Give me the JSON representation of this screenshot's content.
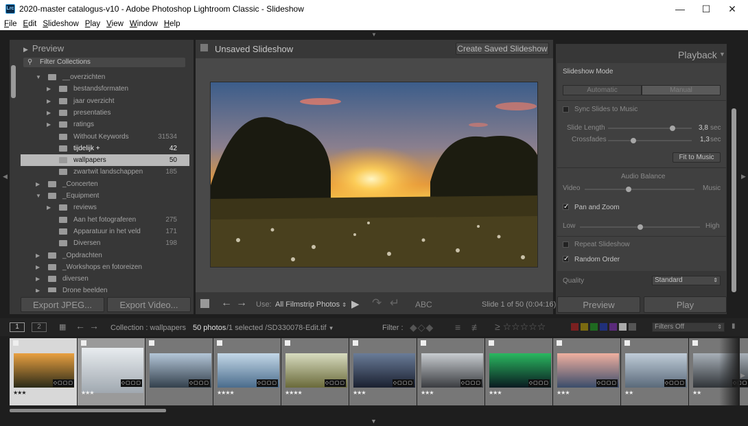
{
  "window": {
    "title": "2020-master catalogus-v10 - Adobe Photoshop Lightroom Classic - Slideshow",
    "logo": "Lrc"
  },
  "menu": [
    "File",
    "Edit",
    "Slideshow",
    "Play",
    "View",
    "Window",
    "Help"
  ],
  "left": {
    "preview_label": "Preview",
    "filter_label": "Filter Collections",
    "tree": [
      {
        "label": "__overzichten",
        "count": "",
        "indent": 0,
        "open": true
      },
      {
        "label": "bestandsformaten",
        "count": "",
        "indent": 1
      },
      {
        "label": "jaar overzicht",
        "count": "",
        "indent": 1
      },
      {
        "label": "presentaties",
        "count": "",
        "indent": 1
      },
      {
        "label": "ratings",
        "count": "",
        "indent": 1
      },
      {
        "label": "Without Keywords",
        "count": "31534",
        "indent": 1,
        "leaf": true
      },
      {
        "label": "tijdelijk  +",
        "count": "42",
        "indent": 1,
        "leaf": true,
        "bold": true
      },
      {
        "label": "wallpapers",
        "count": "50",
        "indent": 1,
        "leaf": true,
        "sel": true
      },
      {
        "label": "zwartwit landschappen",
        "count": "185",
        "indent": 1,
        "leaf": true
      },
      {
        "label": "_Concerten",
        "count": "",
        "indent": 0
      },
      {
        "label": "_Equipment",
        "count": "",
        "indent": 0,
        "open": true
      },
      {
        "label": "reviews",
        "count": "",
        "indent": 1
      },
      {
        "label": "Aan het fotograferen",
        "count": "275",
        "indent": 1,
        "leaf": true
      },
      {
        "label": "Apparatuur in het veld",
        "count": "171",
        "indent": 1,
        "leaf": true
      },
      {
        "label": "Diversen",
        "count": "198",
        "indent": 1,
        "leaf": true
      },
      {
        "label": "_Opdrachten",
        "count": "",
        "indent": 0
      },
      {
        "label": "_Workshops en fotoreizen",
        "count": "",
        "indent": 0
      },
      {
        "label": "diversen",
        "count": "",
        "indent": 0
      },
      {
        "label": "Drone beelden",
        "count": "",
        "indent": 0
      }
    ],
    "export_jpeg": "Export JPEG...",
    "export_video": "Export Video..."
  },
  "center": {
    "title": "Unsaved Slideshow",
    "create_btn": "Create Saved Slideshow",
    "use_label": "Use:",
    "use_value": "All Filmstrip Photos",
    "abc": "ABC",
    "slide_info": "Slide 1 of 50 (0:04:16)"
  },
  "right": {
    "playback": "Playback",
    "mode_label": "Slideshow Mode",
    "automatic": "Automatic",
    "manual": "Manual",
    "sync": "Sync Slides to Music",
    "slide_length": "Slide Length",
    "slide_length_val": "3,8",
    "crossfades": "Crossfades",
    "crossfades_val": "1,3",
    "sec": "sec",
    "fit_music": "Fit to Music",
    "audio_balance": "Audio Balance",
    "video": "Video",
    "music": "Music",
    "pan_zoom": "Pan and Zoom",
    "low": "Low",
    "high": "High",
    "repeat": "Repeat Slideshow",
    "random": "Random Order",
    "quality": "Quality",
    "quality_val": "Standard",
    "preview_btn": "Preview",
    "play_btn": "Play",
    "slide_length_level": 0.77,
    "crossfades_level": 0.3,
    "audio_level": 0.4,
    "panzoom_level": 0.5
  },
  "filmbar": {
    "screen1": "1",
    "screen2": "2",
    "collection": "Collection : wallpapers",
    "count": "50 photos",
    "selected": "/1 selected /SD330078-Edit.tif",
    "filter_label": "Filter :",
    "filters_off": "Filters Off"
  },
  "thumbs": [
    {
      "stars": "★★★",
      "colors": [
        "#e9a040",
        "#2a2a18"
      ]
    },
    {
      "stars": "★★★",
      "colors": [
        "#e8ecef",
        "#a0a8b0"
      ]
    },
    {
      "stars": "",
      "colors": [
        "#b4c6d8",
        "#33404c"
      ]
    },
    {
      "stars": "★★★★",
      "colors": [
        "#c4d8e8",
        "#4a6c8c"
      ]
    },
    {
      "stars": "★★★★",
      "colors": [
        "#d8dcc0",
        "#6a6a3a"
      ]
    },
    {
      "stars": "★★★",
      "colors": [
        "#6a7c98",
        "#1a2030"
      ]
    },
    {
      "stars": "★★★",
      "colors": [
        "#c8ccd0",
        "#3a3c40"
      ]
    },
    {
      "stars": "★★★",
      "colors": [
        "#2ab860",
        "#0a1a20"
      ]
    },
    {
      "stars": "★★★",
      "colors": [
        "#f0b0a0",
        "#3a4c6a"
      ]
    },
    {
      "stars": "★★",
      "colors": [
        "#c0ccd8",
        "#5a6a7a"
      ]
    },
    {
      "stars": "★★",
      "colors": [
        "#a8b0b8",
        "#303438"
      ]
    }
  ]
}
